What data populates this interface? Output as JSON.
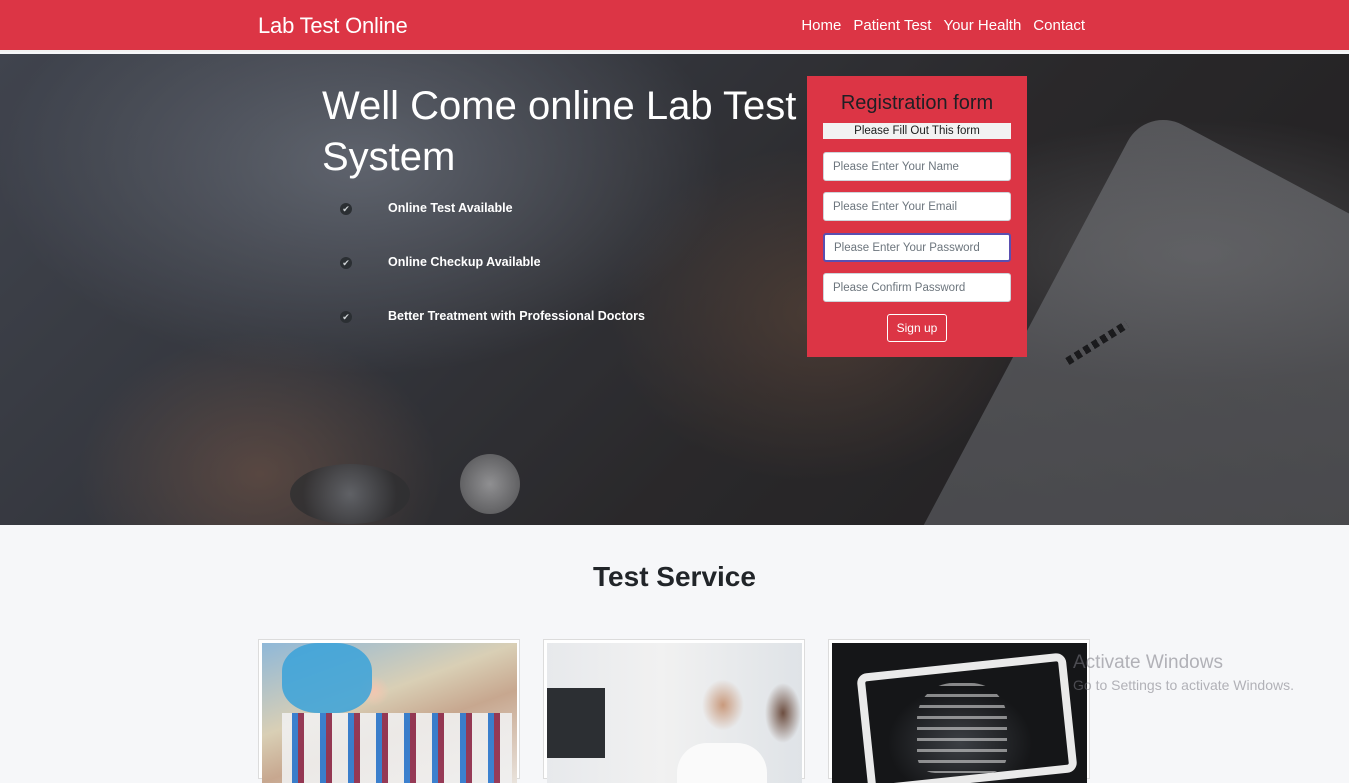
{
  "navbar": {
    "brand": "Lab Test Online",
    "links": [
      "Home",
      "Patient Test",
      "Your Health",
      "Contact"
    ]
  },
  "hero": {
    "title": "Well Come online Lab Test System",
    "features": [
      "Online Test Available",
      "Online Checkup Available",
      "Better Treatment with Professional Doctors"
    ]
  },
  "registration": {
    "title": "Registration form",
    "subtitle": "Please Fill Out This form",
    "name_placeholder": "Please Enter Your Name",
    "email_placeholder": "Please Enter Your Email",
    "password_placeholder": "Please Enter Your Password",
    "confirm_placeholder": "Please Confirm Password",
    "submit_label": "Sign up"
  },
  "services": {
    "title": "Test Service"
  },
  "watermark": {
    "title": "Activate Windows",
    "subtitle": "Go to Settings to activate Windows."
  },
  "colors": {
    "primary": "#dc3545",
    "background": "#f6f7f9"
  }
}
